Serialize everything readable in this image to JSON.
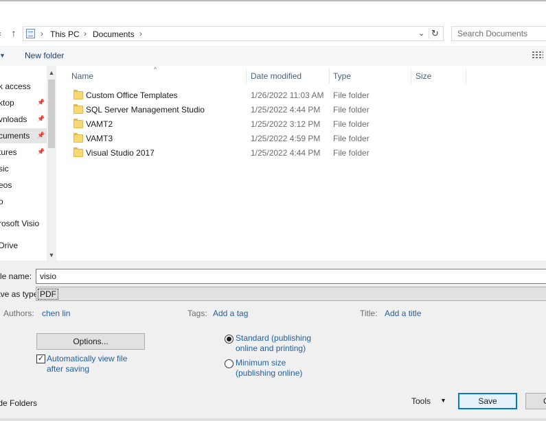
{
  "address": {
    "crumbs": [
      "This PC",
      "Documents"
    ],
    "search_placeholder": "Search Documents"
  },
  "toolbar": {
    "new_folder": "New folder"
  },
  "nav": {
    "items": [
      {
        "label": "k access",
        "pinned": false
      },
      {
        "label": "ktop",
        "pinned": true
      },
      {
        "label": "vnloads",
        "pinned": true
      },
      {
        "label": "cuments",
        "pinned": true,
        "selected": true
      },
      {
        "label": "tures",
        "pinned": true
      },
      {
        "label": "sic",
        "pinned": false
      },
      {
        "label": "eos",
        "pinned": false
      },
      {
        "label": "o",
        "pinned": false
      },
      {
        "label": "rosoft Visio",
        "pinned": false
      },
      {
        "label": "Drive",
        "pinned": false
      }
    ]
  },
  "columns": {
    "name": "Name",
    "date": "Date modified",
    "type": "Type",
    "size": "Size"
  },
  "files": [
    {
      "name": "Custom Office Templates",
      "date": "1/26/2022 11:03 AM",
      "type": "File folder"
    },
    {
      "name": "SQL Server Management Studio",
      "date": "1/25/2022 4:44 PM",
      "type": "File folder"
    },
    {
      "name": "VAMT2",
      "date": "1/25/2022 3:12 PM",
      "type": "File folder"
    },
    {
      "name": "VAMT3",
      "date": "1/25/2022 4:59 PM",
      "type": "File folder"
    },
    {
      "name": "Visual Studio 2017",
      "date": "1/25/2022 4:44 PM",
      "type": "File folder"
    }
  ],
  "form": {
    "file_name_label": "File name:",
    "file_name_value": "visio",
    "save_type_label": "Save as type:",
    "save_type_value": "PDF",
    "authors_label": "Authors:",
    "authors_value": "chen lin",
    "tags_label": "Tags:",
    "tags_value": "Add a tag",
    "title_label": "Title:",
    "title_value": "Add a title",
    "options_button": "Options...",
    "auto_view_label": "Automatically view file after saving",
    "auto_view_checked": true,
    "optimize": [
      {
        "label": "Standard (publishing online and printing)",
        "selected": true
      },
      {
        "label": "Minimum size (publishing online)",
        "selected": false
      }
    ]
  },
  "footer": {
    "hide_folders": "Hide Folders",
    "tools": "Tools",
    "save": "Save",
    "cancel": "Cancel"
  }
}
